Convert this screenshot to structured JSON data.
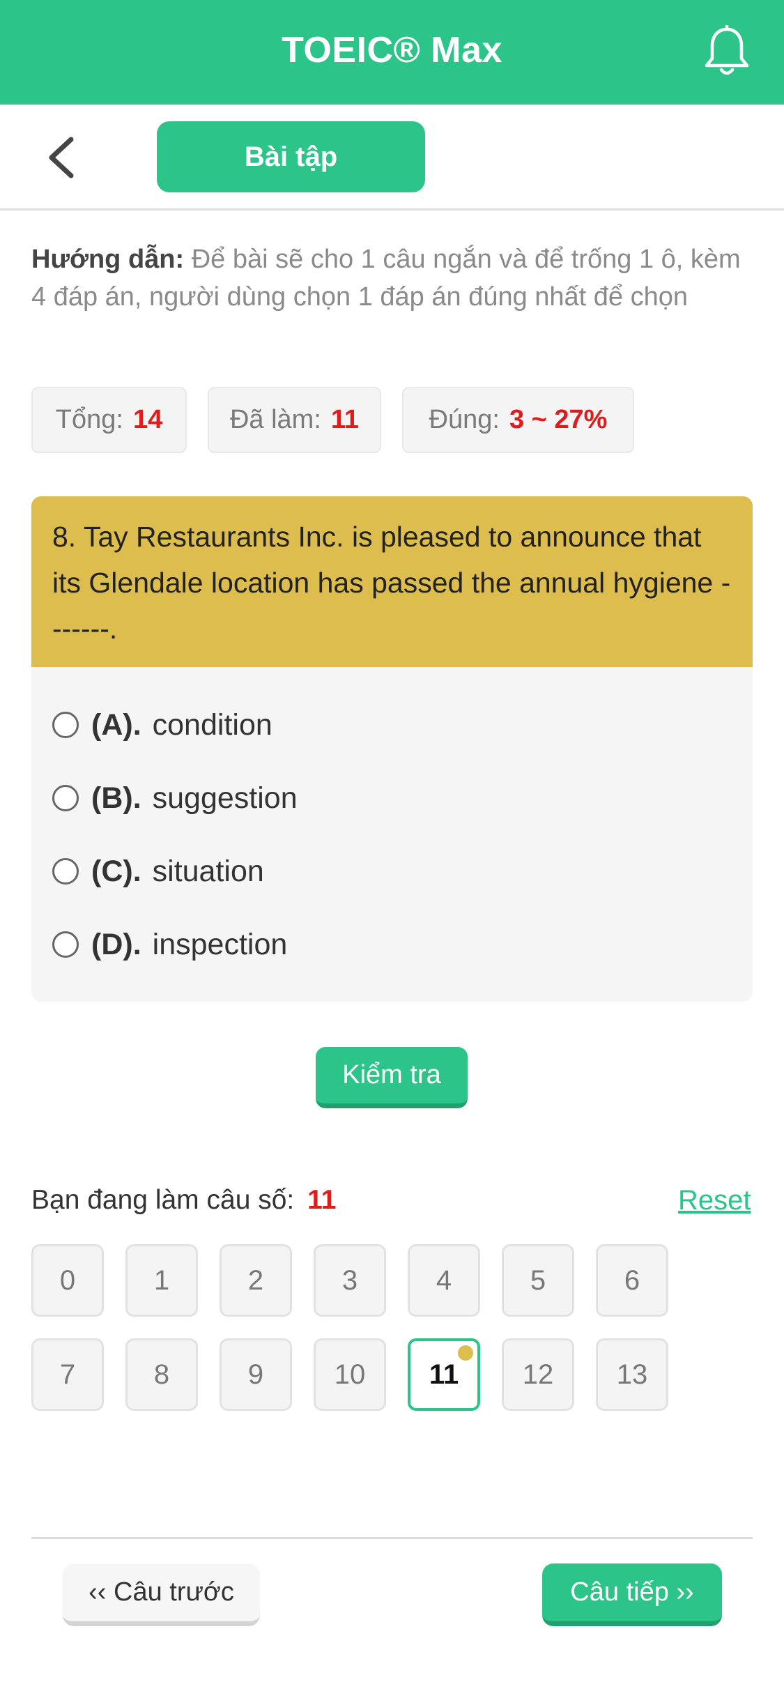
{
  "header": {
    "title": "TOEIC® Max"
  },
  "subheader": {
    "tab_label": "Bài tập"
  },
  "instructions": {
    "label": "Hướng dẫn:",
    "text": "Để bài sẽ cho 1 câu ngắn và để trống 1 ô, kèm 4 đáp án, người dùng chọn 1 đáp án đúng nhất để chọn"
  },
  "stats": {
    "total_label": "Tổng:",
    "total_value": "14",
    "done_label": "Đã làm:",
    "done_value": "11",
    "correct_label": "Đúng:",
    "correct_value": "3 ~ 27%"
  },
  "question": {
    "text": "8. Tay Restaurants Inc. is pleased to announce that its Glendale location has passed the annual hygiene -------.",
    "options": [
      {
        "key": "(A).",
        "text": "condition"
      },
      {
        "key": "(B).",
        "text": "suggestion"
      },
      {
        "key": "(C).",
        "text": "situation"
      },
      {
        "key": "(D).",
        "text": "inspection"
      }
    ]
  },
  "check_button": "Kiểm tra",
  "progress": {
    "label": "Bạn đang làm câu số:",
    "current": "11",
    "reset_label": "Reset",
    "numbers": [
      "0",
      "1",
      "2",
      "3",
      "4",
      "5",
      "6",
      "7",
      "8",
      "9",
      "10",
      "11",
      "12",
      "13"
    ]
  },
  "nav": {
    "prev_label": "‹‹ Câu trước",
    "next_label": "Câu tiếp ››"
  },
  "colors": {
    "primary": "#2dc489",
    "question_header": "#dcbd4e",
    "highlight_number": "#e01b1b"
  },
  "icons": {
    "bell": "bell-icon",
    "back": "chevron-left-icon"
  }
}
